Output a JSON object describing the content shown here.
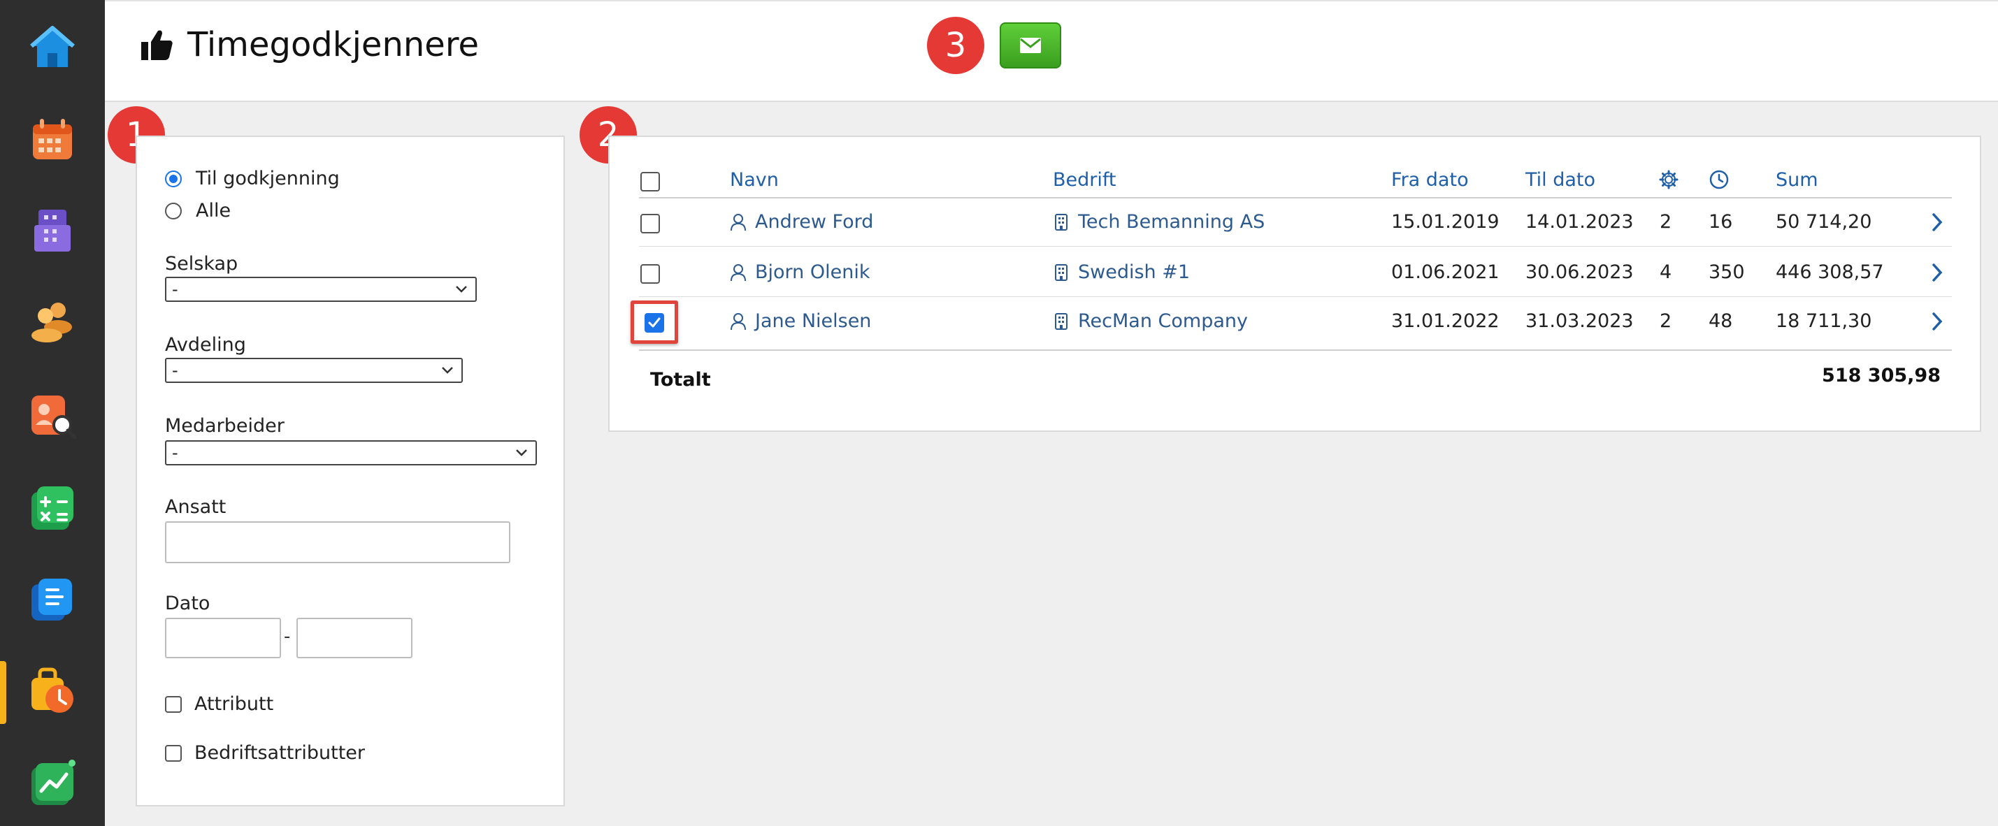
{
  "header": {
    "title": "Timegodkjennere",
    "mail_button_icon": "envelope-icon"
  },
  "badges": [
    "1",
    "2",
    "3"
  ],
  "sidebar": {
    "items": [
      {
        "icon": "home-icon"
      },
      {
        "icon": "calendar-icon"
      },
      {
        "icon": "building-icon"
      },
      {
        "icon": "people-icon"
      },
      {
        "icon": "candidate-search-icon"
      },
      {
        "icon": "calculator-icon"
      },
      {
        "icon": "document-icon"
      },
      {
        "icon": "timesheet-icon",
        "active": true
      },
      {
        "icon": "chart-icon"
      }
    ],
    "active_color": "#f7b21b"
  },
  "filters": {
    "radio_pending": "Til godkjenning",
    "radio_all": "Alle",
    "company_label": "Selskap",
    "company_value": "-",
    "department_label": "Avdeling",
    "department_value": "-",
    "employee_label": "Medarbeider",
    "employee_value": "-",
    "employed_label": "Ansatt",
    "employed_value": "",
    "date_label": "Dato",
    "date_from": "",
    "date_separator": "-",
    "date_to": "",
    "attribute_label": "Attributt",
    "company_attributes_label": "Bedriftsattributter"
  },
  "table": {
    "headers": {
      "name": "Navn",
      "company": "Bedrift",
      "from": "Fra dato",
      "to": "Til dato",
      "sum": "Sum"
    },
    "rows": [
      {
        "name": "Andrew Ford",
        "company": "Tech Bemanning AS",
        "from": "15.01.2019",
        "to": "14.01.2023",
        "count": "2",
        "hours": "16",
        "sum": "50 714,20",
        "checked": false
      },
      {
        "name": "Bjorn Olenik",
        "company": "Swedish #1",
        "from": "01.06.2021",
        "to": "30.06.2023",
        "count": "4",
        "hours": "350",
        "sum": "446 308,57",
        "checked": false
      },
      {
        "name": "Jane Nielsen",
        "company": "RecMan Company",
        "from": "31.01.2022",
        "to": "31.03.2023",
        "count": "2",
        "hours": "48",
        "sum": "18 711,30",
        "checked": true
      }
    ],
    "total_label": "Totalt",
    "total_value": "518 305,98"
  },
  "colors": {
    "accent": "#1f5fa8",
    "badge": "#e53935",
    "mail_button": "#4bb52a"
  }
}
